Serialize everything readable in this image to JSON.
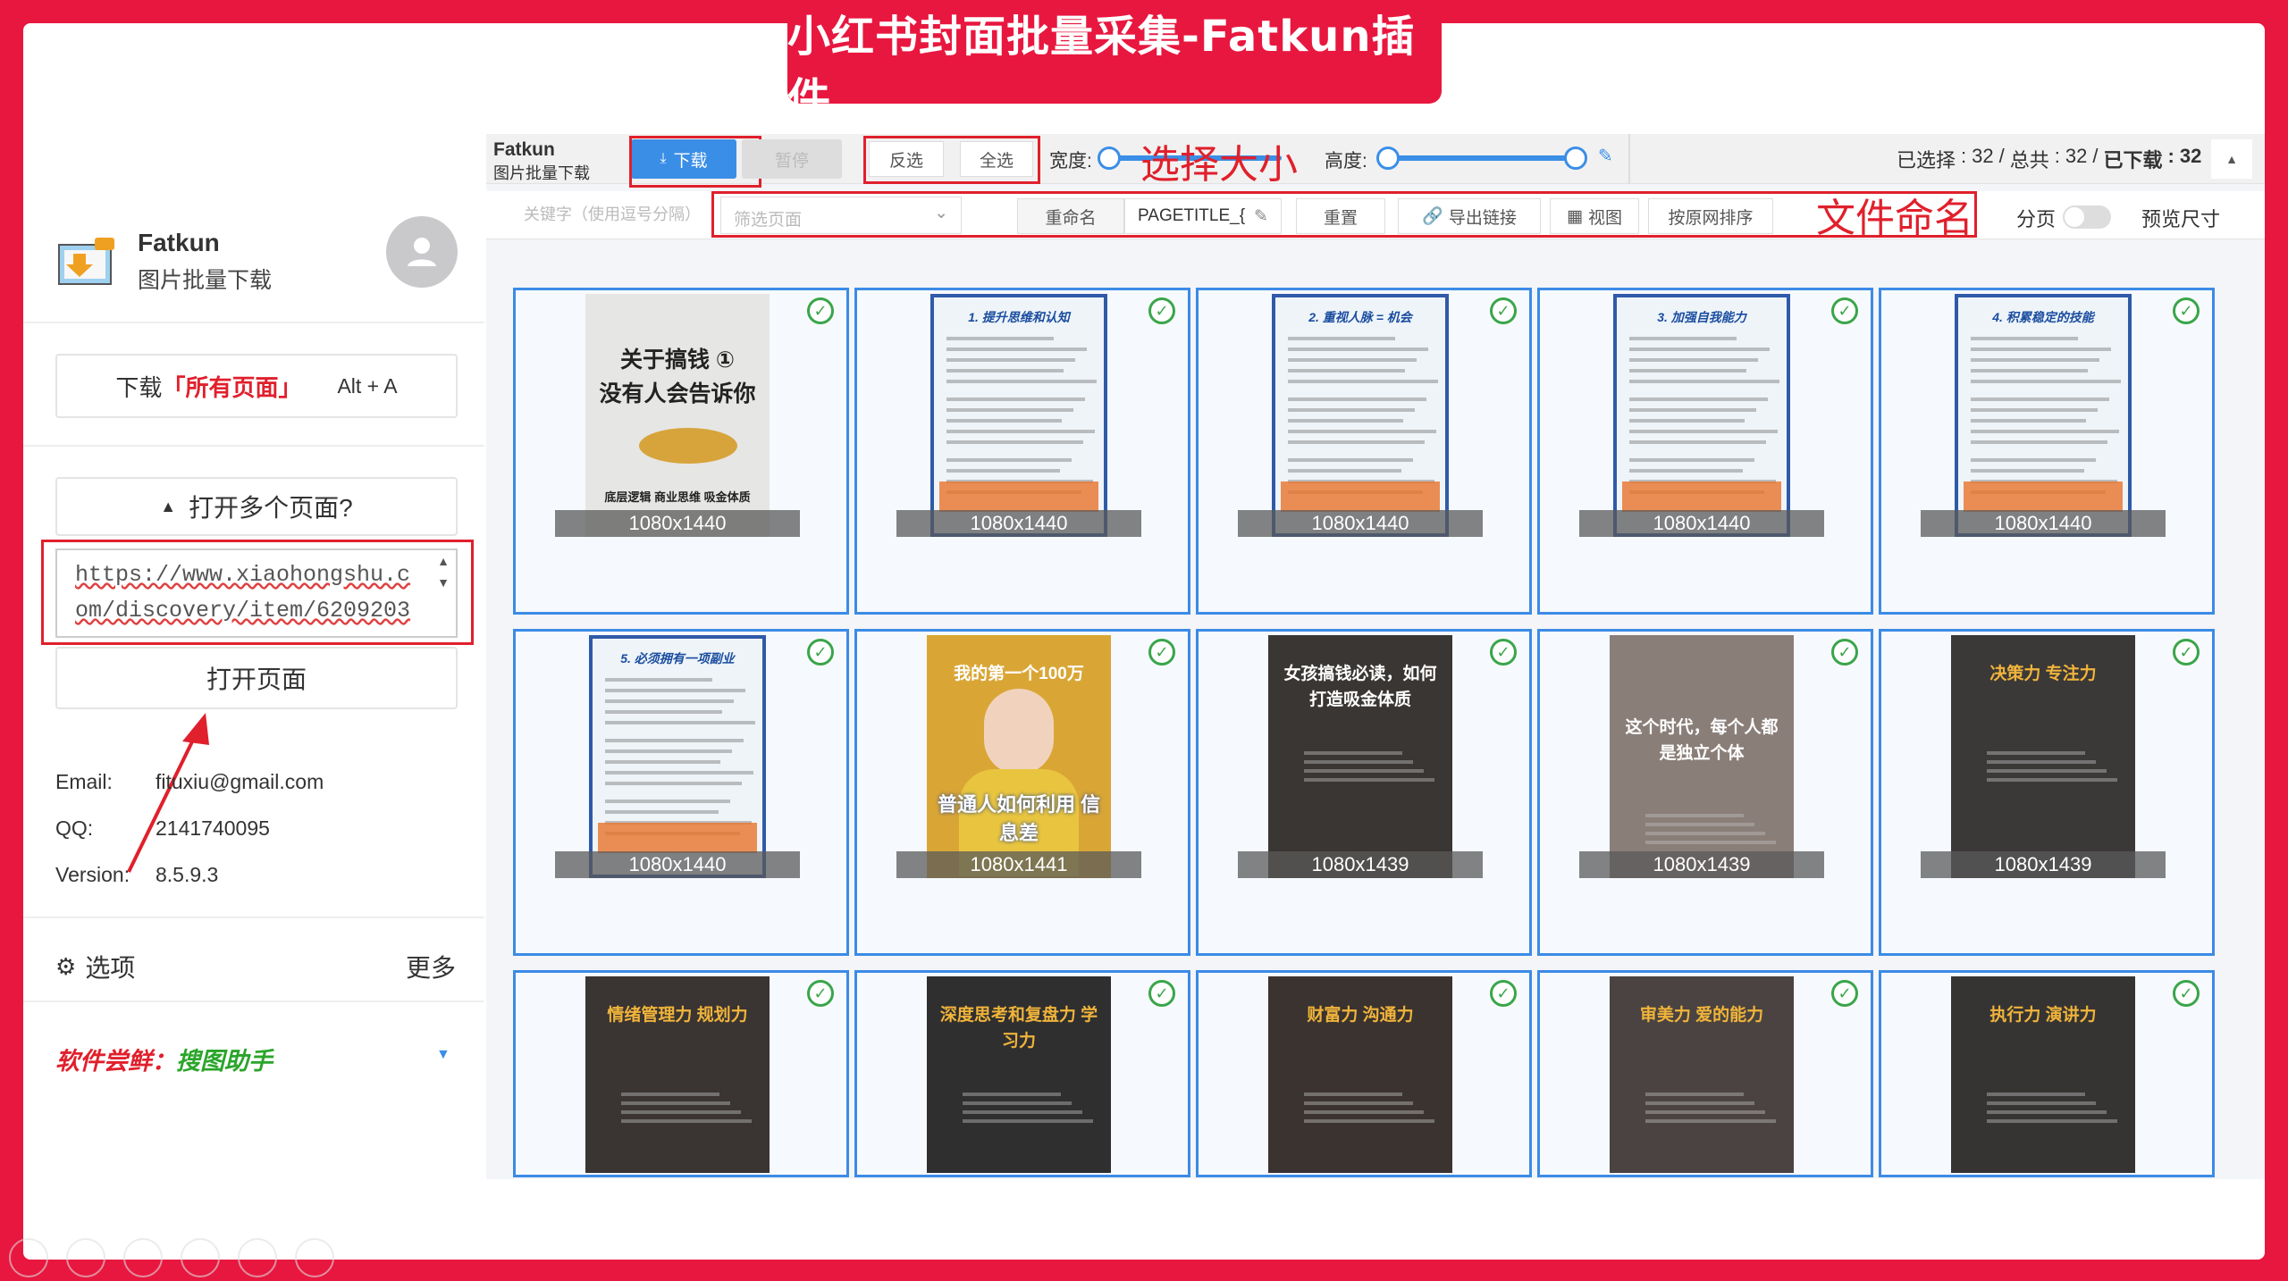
{
  "banner": {
    "title": "小红书封面批量采集-Fatkun插件"
  },
  "left": {
    "app_name": "Fatkun",
    "app_subtitle": "图片批量下载",
    "download_all_prefix": "下载",
    "download_all_strong": "「所有页面」",
    "download_all_shortcut": "Alt + A",
    "open_multiple": "打开多个页面?",
    "url_value": "https://www.xiaohongshu.com/discovery/item/6209203",
    "open_page": "打开页面",
    "email_label": "Email:",
    "email_value": "fituxiu@gmail.com",
    "qq_label": "QQ:",
    "qq_value": "2141740095",
    "version_label": "Version:",
    "version_value": "8.5.9.3",
    "options": "选项",
    "more": "更多",
    "promo_label": "软件尝鲜：",
    "promo_name": "搜图助手"
  },
  "toolbar": {
    "app_name": "Fatkun",
    "app_subtitle": "图片批量下载",
    "download": "下载",
    "pause": "暂停",
    "invert": "反选",
    "select_all": "全选",
    "width_label": "宽度:",
    "height_label": "高度:",
    "annotation_size": "选择大小",
    "status_selected_label": "已选择",
    "status_selected": "32",
    "status_total_label": "总共",
    "status_total": "32",
    "status_downloaded_label": "已下载",
    "status_downloaded": "32",
    "keyword_placeholder": "关键字（使用逗号分隔）",
    "filter_placeholder": "筛选页面",
    "rename": "重命名",
    "pattern": "PAGETITLE_{",
    "reset": "重置",
    "export_links": "导出链接",
    "view": "视图",
    "sort": "按原网排序",
    "annotation_naming": "文件命名",
    "paging": "分页",
    "preview_size": "预览尺寸"
  },
  "grid": [
    {
      "size": "1080x1440",
      "title": "关于搞钱 ①\n没有人会告诉你",
      "bg": "#e6e6e4",
      "fg": "#222",
      "foot": "底层逻辑  商业思维  吸金体质",
      "style": "light"
    },
    {
      "size": "1080x1440",
      "title": "1. 提升思维和认知",
      "bg": "#eef4f8",
      "fg": "#1b4da0",
      "foot": "",
      "style": "doc"
    },
    {
      "size": "1080x1440",
      "title": "2. 重视人脉 = 机会",
      "bg": "#eef4f8",
      "fg": "#1b4da0",
      "foot": "",
      "style": "doc"
    },
    {
      "size": "1080x1440",
      "title": "3. 加强自我能力",
      "bg": "#eef4f8",
      "fg": "#1b4da0",
      "foot": "",
      "style": "doc"
    },
    {
      "size": "1080x1440",
      "title": "4. 积累稳定的技能",
      "bg": "#eef4f8",
      "fg": "#1b4da0",
      "foot": "",
      "style": "doc"
    },
    {
      "size": "1080x1440",
      "title": "5. 必须拥有一项副业",
      "bg": "#eef4f8",
      "fg": "#1b4da0",
      "foot": "",
      "style": "doc"
    },
    {
      "size": "1080x1441",
      "title": "我的第一个100万",
      "bg": "#d9a636",
      "fg": "#ffffff",
      "foot": "普通人如何利用 信息差",
      "style": "portrait"
    },
    {
      "size": "1080x1439",
      "title": "女孩搞钱必读，如何打造吸金体质",
      "bg": "#3a3633",
      "fg": "#ffffff",
      "foot": "",
      "style": "dark"
    },
    {
      "size": "1080x1439",
      "title": "这个时代，每个人都是独立个体",
      "bg": "#8a7e78",
      "fg": "#ffffff",
      "foot": "",
      "style": "soft"
    },
    {
      "size": "1080x1439",
      "title": "决策力  专注力",
      "bg": "#3b3838",
      "fg": "#f0b43a",
      "foot": "",
      "style": "dark"
    },
    {
      "size": "",
      "title": "情绪管理力  规划力",
      "bg": "#3a3433",
      "fg": "#f0b43a",
      "foot": "",
      "style": "dark"
    },
    {
      "size": "",
      "title": "深度思考和复盘力  学习力",
      "bg": "#2f2f30",
      "fg": "#f0b43a",
      "foot": "",
      "style": "dark"
    },
    {
      "size": "",
      "title": "财富力  沟通力",
      "bg": "#3b3330",
      "fg": "#f0b43a",
      "foot": "",
      "style": "dark"
    },
    {
      "size": "",
      "title": "审美力  爱的能力",
      "bg": "#4a4341",
      "fg": "#f0b43a",
      "foot": "",
      "style": "dark"
    },
    {
      "size": "",
      "title": "执行力  演讲力",
      "bg": "#363433",
      "fg": "#f0b43a",
      "foot": "",
      "style": "dark"
    }
  ],
  "colors": {
    "accent": "#e8173f",
    "primary": "#3a8ee6",
    "check": "#3aa54a",
    "promo_red": "#e0202c",
    "promo_green": "#2aa52a"
  }
}
